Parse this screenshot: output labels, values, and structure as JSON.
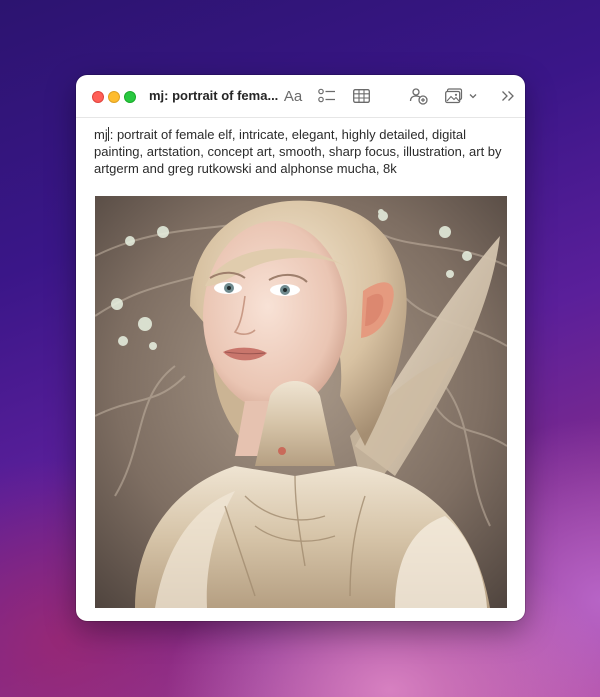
{
  "window": {
    "title": "mj: portrait of fema..."
  },
  "toolbar": {
    "format_label": "Aa",
    "icons": [
      "checklist-icon",
      "table-icon",
      "collaborate-icon",
      "media-icon",
      "chevron-down-icon",
      "more-icon"
    ]
  },
  "note": {
    "text_before_cursor": "mj",
    "text_after_cursor": ": portrait of female elf, intricate, elegant, highly detailed, digital painting, artstation, concept art, smooth, sharp focus, illustration, art by artgerm and greg rutkowski and alphonse mucha, 8k"
  },
  "image": {
    "subject": "portrait of a female elf with blonde hair and ornate white armor"
  },
  "colors": {
    "close": "#ff5f57",
    "minimize": "#febc2e",
    "zoom": "#28c840"
  }
}
